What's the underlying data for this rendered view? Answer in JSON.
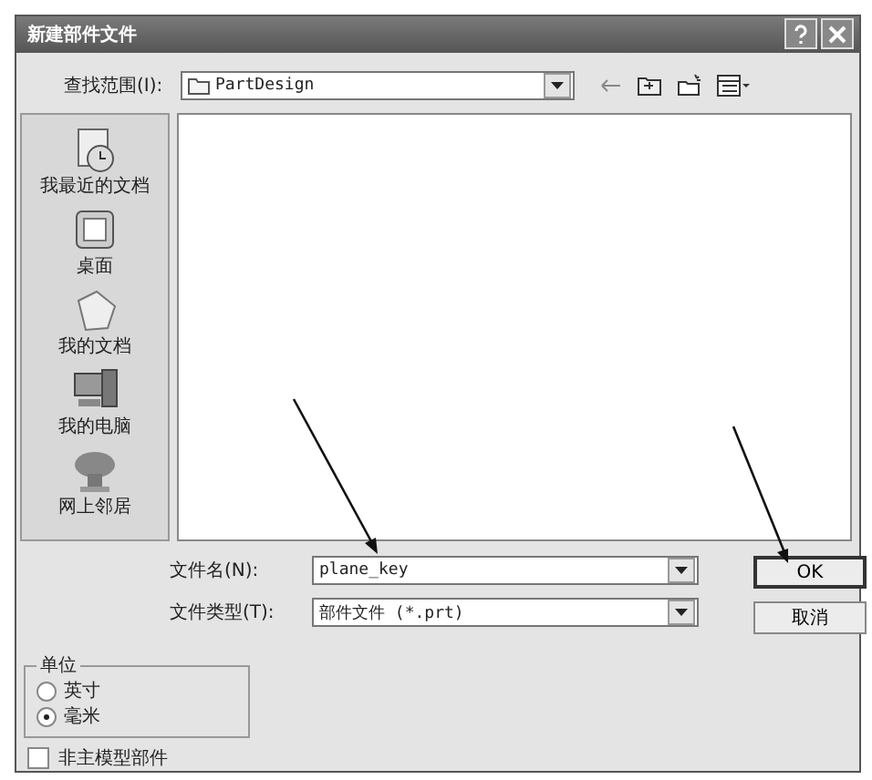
{
  "window": {
    "title": "新建部件文件"
  },
  "look_in": {
    "label": "查找范围(I):",
    "value": "PartDesign"
  },
  "places": [
    {
      "label": "我最近的文档",
      "kind": "recent"
    },
    {
      "label": "桌面",
      "kind": "desktop"
    },
    {
      "label": "我的文档",
      "kind": "documents"
    },
    {
      "label": "我的电脑",
      "kind": "computer"
    },
    {
      "label": "网上邻居",
      "kind": "network"
    }
  ],
  "file_name": {
    "label": "文件名(N):",
    "value": "plane_key"
  },
  "file_type": {
    "label": "文件类型(T):",
    "value": "部件文件 (*.prt)"
  },
  "buttons": [
    {
      "label": "OK",
      "default": true
    },
    {
      "label": "取消",
      "default": false
    }
  ],
  "units": {
    "title": "单位",
    "options": [
      {
        "label": "英寸",
        "selected": false
      },
      {
        "label": "毫米",
        "selected": true
      }
    ]
  },
  "non_master": {
    "label": "非主模型部件",
    "checked": false
  }
}
